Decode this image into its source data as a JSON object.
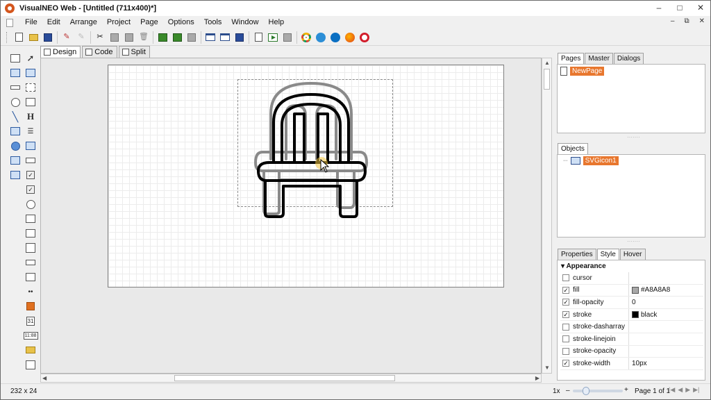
{
  "window": {
    "title": "VisualNEO Web - [Untitled (711x400)*]",
    "controls": [
      "–",
      "□",
      "✕"
    ],
    "mdi_controls": [
      "–",
      "⧉",
      "✕"
    ]
  },
  "menubar": [
    "File",
    "Edit",
    "Arrange",
    "Project",
    "Page",
    "Options",
    "Tools",
    "Window",
    "Help"
  ],
  "editor_tabs": [
    "Design",
    "Code",
    "Split"
  ],
  "pages_panel": {
    "tabs": [
      "Pages",
      "Master",
      "Dialogs"
    ],
    "items": [
      "NewPage"
    ]
  },
  "objects_panel": {
    "tabs": [
      "Objects"
    ],
    "items": [
      "SVGicon1"
    ]
  },
  "properties_panel": {
    "tabs": [
      "Properties",
      "Style",
      "Hover"
    ],
    "section": "Appearance",
    "rows": [
      {
        "checked": false,
        "name": "cursor",
        "value": "",
        "swatch": ""
      },
      {
        "checked": true,
        "name": "fill",
        "value": "#A8A8A8",
        "swatch": "#A8A8A8"
      },
      {
        "checked": true,
        "name": "fill-opacity",
        "value": "0",
        "swatch": ""
      },
      {
        "checked": true,
        "name": "stroke",
        "value": "black",
        "swatch": "#000000"
      },
      {
        "checked": false,
        "name": "stroke-dasharray",
        "value": "",
        "swatch": ""
      },
      {
        "checked": false,
        "name": "stroke-linejoin",
        "value": "",
        "swatch": ""
      },
      {
        "checked": false,
        "name": "stroke-opacity",
        "value": "",
        "swatch": ""
      },
      {
        "checked": true,
        "name": "stroke-width",
        "value": "10px",
        "swatch": ""
      }
    ]
  },
  "status": {
    "size": "232 x 24",
    "zoom": "1x",
    "minus": "–",
    "plus": "+",
    "page": "Page 1 of 1",
    "nav": [
      "|◀",
      "◀",
      "▶",
      "▶|"
    ]
  },
  "tool_labels": {
    "heading": "H",
    "clock": "11:88",
    "calendar": "31"
  },
  "colors": {
    "selection": "#e8772e",
    "app_icon": "#d4561d"
  }
}
